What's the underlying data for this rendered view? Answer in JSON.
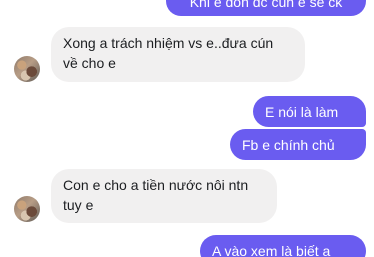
{
  "accent_color": "#6a5cf0",
  "incoming_bg": "#f1f0f0",
  "messages": [
    {
      "side": "out",
      "text": "Khi e đón đc cún e sẽ ck"
    },
    {
      "side": "in",
      "lines": [
        "Xong a trách nhiệm vs e..đưa cún",
        "về cho e"
      ]
    },
    {
      "side": "out",
      "text": "E nói là làm"
    },
    {
      "side": "out",
      "text": "Fb e chính chủ"
    },
    {
      "side": "in",
      "lines": [
        "Con e cho a tiền nước nôi ntn",
        "tuy e"
      ]
    },
    {
      "side": "out",
      "text": "A vào xem là biết a"
    }
  ],
  "avatar_icon": "user-avatar-photo"
}
